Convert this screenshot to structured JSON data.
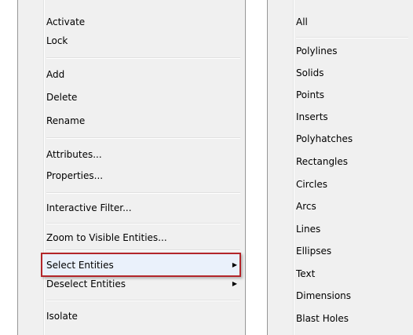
{
  "context_menu": {
    "items": [
      {
        "label": "Activate"
      },
      {
        "label": "Lock"
      },
      {
        "label": "Add"
      },
      {
        "label": "Delete"
      },
      {
        "label": "Rename"
      },
      {
        "label": "Attributes..."
      },
      {
        "label": "Properties..."
      },
      {
        "label": "Interactive Filter..."
      },
      {
        "label": "Zoom to Visible Entities..."
      },
      {
        "label": "Select Entities",
        "submenu_arrow": "▶",
        "highlighted": true
      },
      {
        "label": "Deselect Entities",
        "submenu_arrow": "▶"
      },
      {
        "label": "Isolate"
      }
    ],
    "highlight_color": "#b3262b"
  },
  "entities_submenu": {
    "items": [
      {
        "label": "All"
      },
      {
        "label": "Polylines"
      },
      {
        "label": "Solids"
      },
      {
        "label": "Points"
      },
      {
        "label": "Inserts"
      },
      {
        "label": "Polyhatches"
      },
      {
        "label": "Rectangles"
      },
      {
        "label": "Circles"
      },
      {
        "label": "Arcs"
      },
      {
        "label": "Lines"
      },
      {
        "label": "Ellipses"
      },
      {
        "label": "Text"
      },
      {
        "label": "Dimensions"
      },
      {
        "label": "Blast Holes"
      }
    ]
  }
}
